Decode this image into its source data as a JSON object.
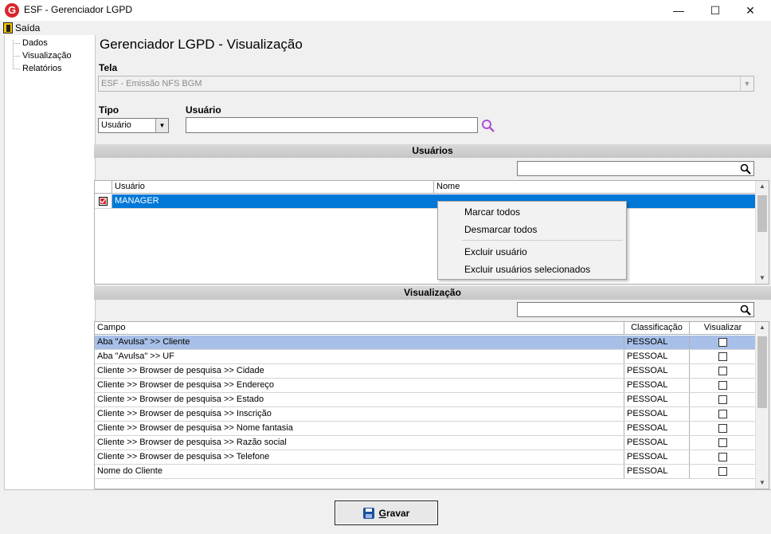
{
  "window": {
    "title": "ESF - Gerenciador LGPD",
    "minimize": "—",
    "maximize": "☐",
    "close": "✕"
  },
  "menu": {
    "exit_label": "Saída"
  },
  "tree": {
    "items": [
      "Dados",
      "Visualização",
      "Relatórios"
    ]
  },
  "page_title": "Gerenciador LGPD - Visualização",
  "tela": {
    "label": "Tela",
    "value": "ESF - Emissão NFS BGM"
  },
  "tipo": {
    "label": "Tipo",
    "value": "Usuário"
  },
  "usuario": {
    "label": "Usuário",
    "value": ""
  },
  "usuarios_section": {
    "title": "Usuários",
    "filter_value": "",
    "columns": [
      "Usuário",
      "Nome"
    ],
    "rows": [
      {
        "checked": true,
        "usuario": "MANAGER",
        "nome": ""
      }
    ]
  },
  "context_menu": {
    "items": [
      "Marcar todos",
      "Desmarcar todos",
      "Excluir usuário",
      "Excluir usuários selecionados"
    ]
  },
  "visualizacao_section": {
    "title": "Visualização",
    "filter_value": "",
    "columns": [
      "Campo",
      "Classificação",
      "Visualizar"
    ],
    "rows": [
      {
        "campo": "Aba \"Avulsa\" >> Cliente",
        "classificacao": "PESSOAL",
        "visualizar": false,
        "highlighted": true
      },
      {
        "campo": "Aba \"Avulsa\" >> UF",
        "classificacao": "PESSOAL",
        "visualizar": false
      },
      {
        "campo": "Cliente >> Browser de pesquisa >> Cidade",
        "classificacao": "PESSOAL",
        "visualizar": false
      },
      {
        "campo": "Cliente >> Browser de pesquisa >> Endereço",
        "classificacao": "PESSOAL",
        "visualizar": false
      },
      {
        "campo": "Cliente >> Browser de pesquisa >> Estado",
        "classificacao": "PESSOAL",
        "visualizar": false
      },
      {
        "campo": "Cliente >> Browser de pesquisa >> Inscrição",
        "classificacao": "PESSOAL",
        "visualizar": false
      },
      {
        "campo": "Cliente >> Browser de pesquisa >> Nome fantasia",
        "classificacao": "PESSOAL",
        "visualizar": false
      },
      {
        "campo": "Cliente >> Browser de pesquisa >> Razão social",
        "classificacao": "PESSOAL",
        "visualizar": false
      },
      {
        "campo": "Cliente >> Browser de pesquisa >> Telefone",
        "classificacao": "PESSOAL",
        "visualizar": false
      },
      {
        "campo": "Nome do Cliente",
        "classificacao": "PESSOAL",
        "visualizar": false
      }
    ]
  },
  "save_button": {
    "label": "Gravar",
    "icon": "disk-icon"
  },
  "colors": {
    "selection": "#0078d7",
    "highlight": "#a8c0e8",
    "search_accent": "#b04fd6",
    "brand": "#d9262b"
  }
}
